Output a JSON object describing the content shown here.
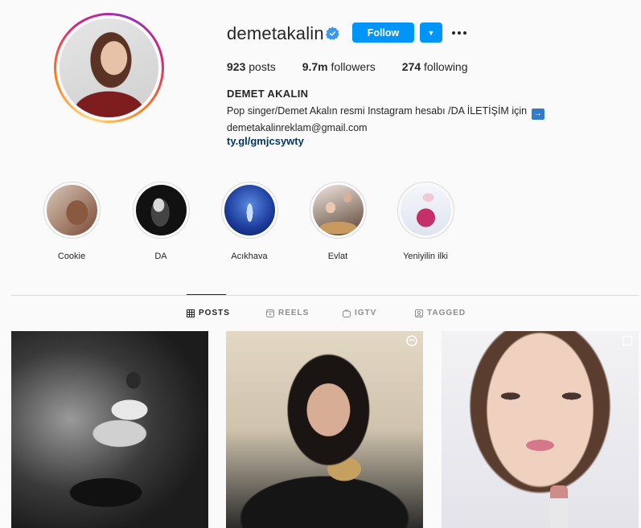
{
  "profile": {
    "username": "demetakalin",
    "verified": true,
    "follow_label": "Follow",
    "dropdown_icon": "chevron-down-icon",
    "more_icon": "more-options-icon",
    "posts_count": "923",
    "posts_label": "posts",
    "followers_count": "9.7m",
    "followers_label": "followers",
    "following_count": "274",
    "following_label": "following",
    "full_name": "DEMET AKALIN",
    "bio_line": "Pop singer/Demet Akalın resmi Instagram hesabı /DA İLETİŞİM için",
    "bio_arrow": "→",
    "bio_email": "demetakalinreklam@gmail.com",
    "link": "ty.gl/gmjcsywty"
  },
  "highlights": [
    {
      "label": "Cookie"
    },
    {
      "label": "DA"
    },
    {
      "label": "Acıkhava"
    },
    {
      "label": "Evlat"
    },
    {
      "label": "Yeniyilin ilki"
    }
  ],
  "tabs": [
    {
      "label": "POSTS",
      "icon": "grid-icon",
      "active": true
    },
    {
      "label": "REELS",
      "icon": "reels-icon",
      "active": false
    },
    {
      "label": "IGTV",
      "icon": "igtv-icon",
      "active": false
    },
    {
      "label": "TAGGED",
      "icon": "tagged-icon",
      "active": false
    }
  ],
  "colors": {
    "accent": "#0095f6",
    "link": "#00376b",
    "text": "#262626",
    "muted": "#8e8e8e",
    "background": "#fafafa"
  }
}
